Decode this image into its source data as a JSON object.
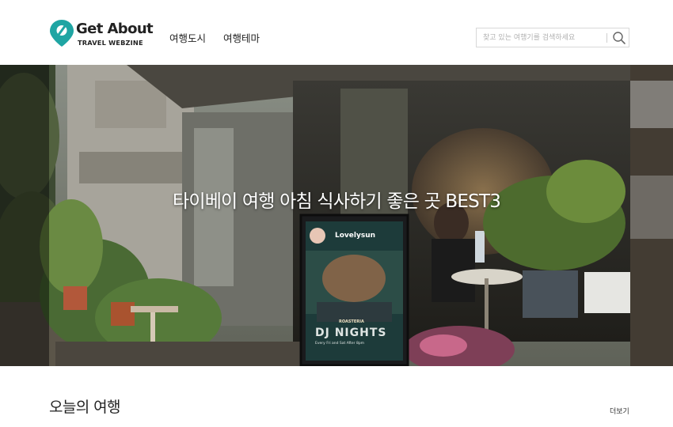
{
  "brand": {
    "title": "Get About",
    "subtitle": "TRAVEL WEBZINE",
    "accent_color": "#1fa5a3"
  },
  "nav": {
    "items": [
      {
        "label": "여행도시"
      },
      {
        "label": "여행테마"
      }
    ]
  },
  "search": {
    "placeholder": "찾고 있는 여행기를 검색하세요",
    "icon": "search-icon"
  },
  "hero": {
    "title": "타이베이 여행 아침 식사하기 좋은 곳 BEST3",
    "poster": {
      "user": "Lovelysun",
      "headline": "DJ NIGHTS",
      "line1": "Every Fri and Sat After 8pm",
      "tag": "ROASTERIA"
    }
  },
  "section": {
    "title": "오늘의 여행",
    "more_label": "더보기"
  }
}
